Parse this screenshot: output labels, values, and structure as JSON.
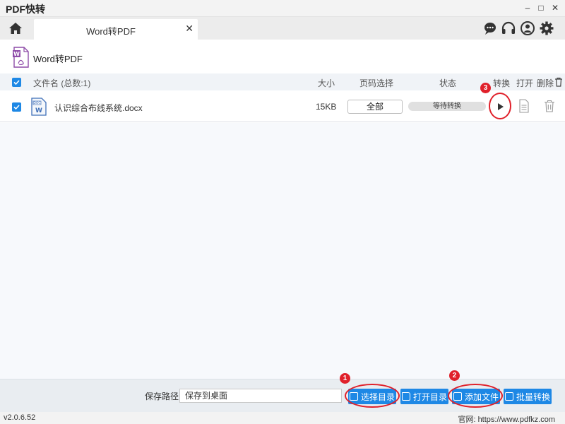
{
  "app": {
    "title": "PDF快转"
  },
  "window_controls": {
    "minimize": "–",
    "maximize": "□",
    "close": "✕"
  },
  "tabs": [
    {
      "label": "Word转PDF",
      "close": "✕"
    }
  ],
  "toolbar_icons": [
    "chat-icon",
    "headset-icon",
    "user-icon",
    "gear-icon"
  ],
  "section": {
    "title": "Word转PDF"
  },
  "table": {
    "headers": {
      "filename": "文件名 (总数:1)",
      "size": "大小",
      "pages": "页码选择",
      "status": "状态",
      "convert": "转换",
      "open": "打开",
      "delete": "删除"
    },
    "rows": [
      {
        "filename": "认识综合布线系统.docx",
        "size": "15KB",
        "pages": "全部",
        "status": "等待转换",
        "icon_text": "DOC",
        "icon_letter": "W"
      }
    ]
  },
  "bottom": {
    "path_label": "保存路径:",
    "path_value": "保存到桌面",
    "buttons": {
      "select_dir": "选择目录",
      "open_dir": "打开目录",
      "add_file": "添加文件",
      "batch_convert": "批量转换"
    }
  },
  "status": {
    "version": "v2.0.6.52",
    "website": "官网: https://www.pdfkz.com"
  },
  "annotations": {
    "n1": "1",
    "n2": "2",
    "n3": "3"
  },
  "colors": {
    "accent": "#1e88e5",
    "annotation": "#e0202a",
    "word_icon": "#3f6fb8",
    "pdf_icon": "#8e4ca8"
  }
}
